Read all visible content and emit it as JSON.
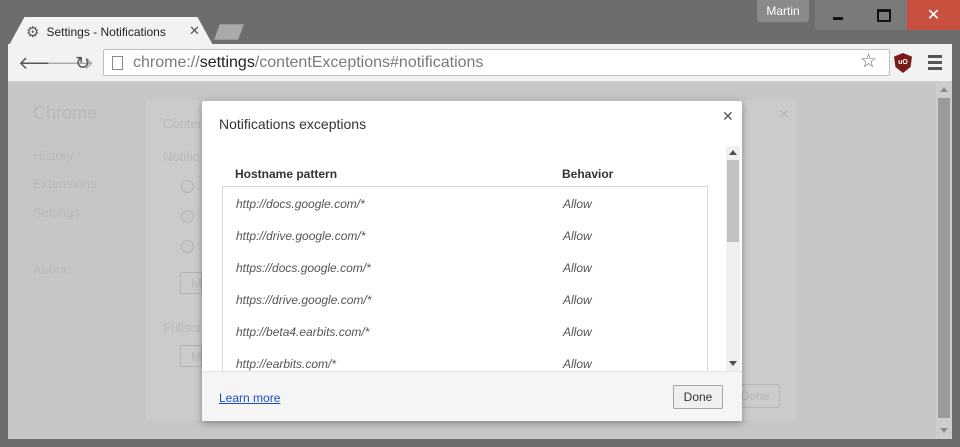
{
  "window": {
    "profile_name": "Martin",
    "controls": [
      "minimize",
      "maximize",
      "close"
    ]
  },
  "tab": {
    "title": "Settings - Notifications",
    "icon": "gear-icon"
  },
  "toolbar": {
    "url_scheme": "chrome://",
    "url_host": "settings",
    "url_path": "/contentExceptions#notifications"
  },
  "background_page": {
    "sidebar_title": "Chrome",
    "sidebar_items": [
      "History",
      "Extensions",
      "Settings",
      "About"
    ],
    "section_label": "Content",
    "notifications_label": "Notific",
    "fullscreen_label": "Fullscre",
    "manage_button": "M",
    "done_label": "Done"
  },
  "dialog": {
    "title": "Notifications exceptions",
    "columns": {
      "hostname": "Hostname pattern",
      "behavior": "Behavior"
    },
    "rows": [
      {
        "host": "http://docs.google.com/*",
        "behavior": "Allow"
      },
      {
        "host": "http://drive.google.com/*",
        "behavior": "Allow"
      },
      {
        "host": "https://docs.google.com/*",
        "behavior": "Allow"
      },
      {
        "host": "https://drive.google.com/*",
        "behavior": "Allow"
      },
      {
        "host": "http://beta4.earbits.com/*",
        "behavior": "Allow"
      },
      {
        "host": "http://earbits.com/*",
        "behavior": "Allow"
      }
    ],
    "learn_more": "Learn more",
    "done": "Done"
  },
  "colors": {
    "titlebar": "#6d6d6d",
    "close_button": "#c7503f",
    "link": "#1a4ec8",
    "ublock": "#7a1b1b"
  }
}
